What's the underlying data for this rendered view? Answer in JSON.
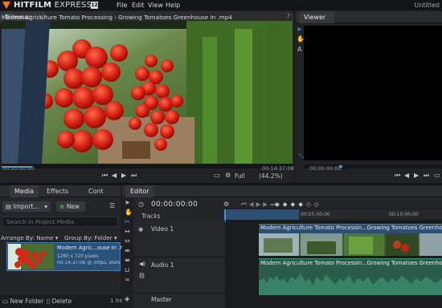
{
  "app": {
    "brand_bold": "HITFILM",
    "brand_rest": " EXPRESS",
    "version": "12",
    "project_title": "Untitled"
  },
  "menu": [
    "File",
    "Edit",
    "View",
    "Help"
  ],
  "trimmer": {
    "tab": "Trimmer",
    "clip_title": "Modern Agriculture Tomato Processing - Growing Tomatoes Greenhouse In .mp4",
    "time_start": "00:00:00:00",
    "time_end": "00:14:37:08",
    "full_label": "Full",
    "zoom_label": "(44.2%)"
  },
  "viewer": {
    "tab": "Viewer",
    "time": "00:00:00:00"
  },
  "media_panel": {
    "tabs": [
      "Media",
      "Effects",
      "Cont"
    ],
    "import_label": "Import...",
    "new_label": "New",
    "search_placeholder": "Search in Project Media",
    "arrange_label": "Arrange By: Name",
    "group_label": "Group By: Folder",
    "item_name": "Modern Agric...ouse In .mp4",
    "item_meta1": "1280 x 720 pixels",
    "item_meta2": "00:14:37:08 @ 30fps, stereo",
    "new_folder_label": "New Folder",
    "delete_label": "Delete",
    "count_label": "1 Ite"
  },
  "editor": {
    "tab": "Editor",
    "timecode": "00:00:00:00",
    "tracks_label": "Tracks",
    "ruler_marks": [
      "00:05:00:00",
      "00:10:00:00"
    ],
    "video_track": "Video 1",
    "audio_track": "Audio 1",
    "master_track": "Master",
    "video_clip_title": "Modern Agriculture Tomato Processin...Growing Tomatoes Greenhouse",
    "audio_clip_title": "Modern Agriculture Tomato Processin...Growing Tomatoes Greenhouse"
  },
  "colors": {
    "accent": "#3a9ad9",
    "brand": "#f47b20",
    "video_clip": "#2c4f72",
    "audio_clip": "#2a5c4c"
  }
}
